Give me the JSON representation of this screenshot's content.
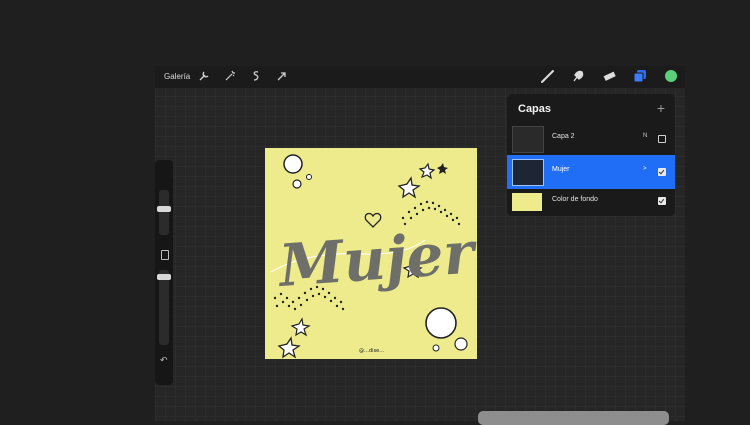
{
  "toolbar": {
    "gallery_label": "Galería",
    "icons": [
      "wrench-icon",
      "magic-wand-icon",
      "selection-icon",
      "transform-arrow-icon"
    ],
    "right_icons": [
      "brush-icon",
      "smudge-icon",
      "eraser-icon",
      "layers-icon",
      "color-icon"
    ],
    "accent_layers": "#2d6cf0",
    "accent_color_dot": "#5ad07c"
  },
  "canvas": {
    "background_color": "#eeeb8d",
    "artwork_title": "Mujer",
    "signature": "@…dise…"
  },
  "layers": {
    "title": "Capas",
    "add_symbol": "+",
    "items": [
      {
        "name": "Capa 2",
        "mode": "N",
        "visible": false,
        "active": false
      },
      {
        "name": "Mujer",
        "mode": ">",
        "visible": true,
        "active": true
      },
      {
        "name": "Color de fondo",
        "mode": "",
        "visible": true,
        "active": false
      }
    ],
    "active_color": "#1f6ef5"
  },
  "left_sidebar": {
    "size_level": 0.2,
    "opacity_level": 0.2
  }
}
